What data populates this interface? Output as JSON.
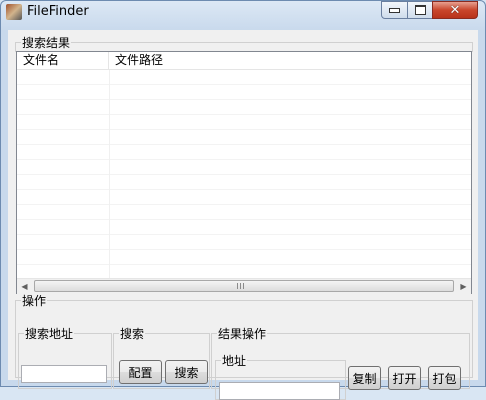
{
  "window": {
    "title": "FileFinder"
  },
  "results_group": {
    "label": "搜索结果"
  },
  "list": {
    "columns": [
      "文件名",
      "文件路径"
    ],
    "rows": []
  },
  "scrollbar": {
    "grip": "III"
  },
  "operations": {
    "label": "操作",
    "search_address": {
      "label": "搜索地址",
      "value": ""
    },
    "search": {
      "label": "搜索",
      "config_button": "配置",
      "search_button": "搜索"
    },
    "result_ops": {
      "label": "结果操作",
      "address": {
        "label": "地址",
        "value": ""
      },
      "copy_button": "复制",
      "open_button": "打开",
      "pack_button": "打包"
    }
  }
}
